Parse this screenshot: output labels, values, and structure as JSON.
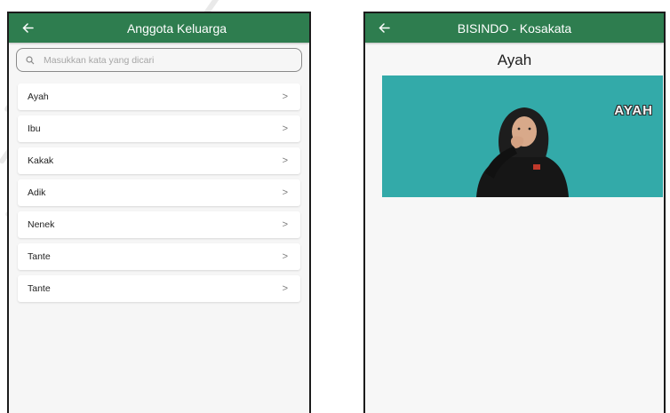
{
  "left_screen": {
    "appbar": {
      "title": "Anggota Keluarga",
      "back_icon": "arrow-left-icon"
    },
    "search": {
      "placeholder": "Masukkan kata yang dicari",
      "value": ""
    },
    "items": [
      {
        "label": "Ayah"
      },
      {
        "label": "Ibu"
      },
      {
        "label": "Kakak"
      },
      {
        "label": "Adik"
      },
      {
        "label": "Nenek"
      },
      {
        "label": "Tante"
      },
      {
        "label": "Tante"
      }
    ],
    "chevron": ">"
  },
  "right_screen": {
    "appbar": {
      "title": "BISINDO - Kosakata",
      "back_icon": "arrow-left-icon"
    },
    "word": "Ayah",
    "video": {
      "overlay_text": "AYAH"
    }
  },
  "colors": {
    "appbar": "#2e7d4f",
    "video_bg": "#33aaa9",
    "background": "#f6f6f6"
  }
}
